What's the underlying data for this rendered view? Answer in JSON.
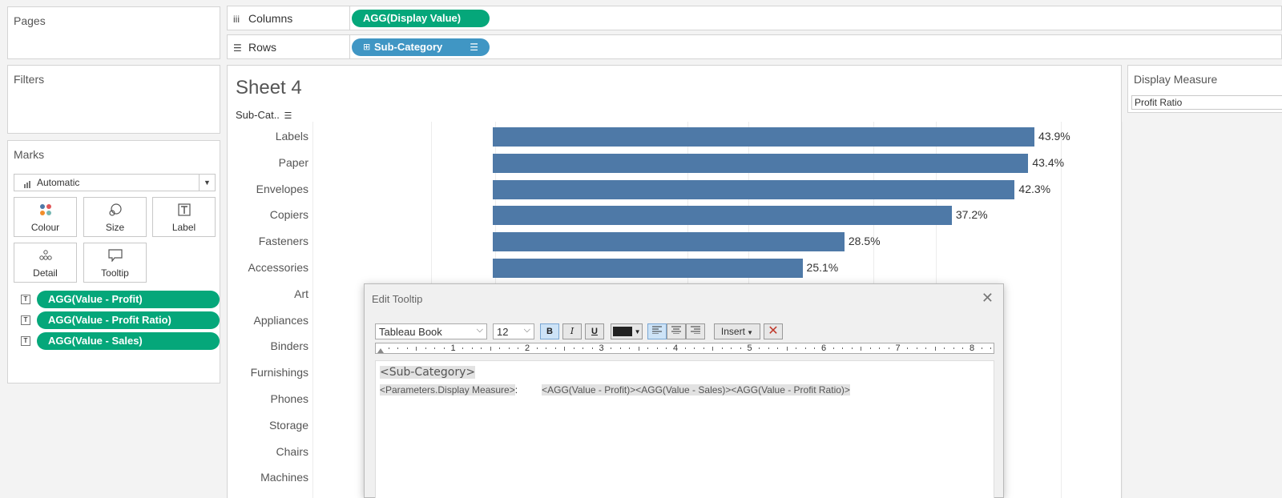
{
  "pages": {
    "title": "Pages"
  },
  "filters": {
    "title": "Filters"
  },
  "marks": {
    "title": "Marks",
    "mark_type": "Automatic",
    "buttons": [
      "Colour",
      "Size",
      "Label",
      "Detail",
      "Tooltip"
    ],
    "pills": [
      "AGG(Value - Profit)",
      "AGG(Value - Profit Ratio)",
      "AGG(Value - Sales)"
    ]
  },
  "columns_shelf": {
    "label": "Columns",
    "pill": "AGG(Display Value)"
  },
  "rows_shelf": {
    "label": "Rows",
    "pill": "Sub-Category"
  },
  "sheet": {
    "title": "Sheet 4",
    "row_header": "Sub-Cat.."
  },
  "chart_data": {
    "type": "bar",
    "categories": [
      "Labels",
      "Paper",
      "Envelopes",
      "Copiers",
      "Fasteners",
      "Accessories",
      "Art",
      "Appliances",
      "Binders",
      "Furnishings",
      "Phones",
      "Storage",
      "Chairs",
      "Machines"
    ],
    "values": [
      43.9,
      43.4,
      42.3,
      37.2,
      28.5,
      25.1,
      null,
      null,
      null,
      null,
      null,
      null,
      null,
      null
    ],
    "data_labels": [
      "43.9%",
      "43.4%",
      "42.3%",
      "37.2%",
      "28.5%",
      "25.1%",
      "",
      "",
      "",
      "",
      "",
      "",
      "",
      ""
    ],
    "title": "Sheet 4",
    "xlabel": "",
    "ylabel": "Sub-Cat..",
    "grid": true,
    "colors": {
      "bar": "#4e79a7"
    }
  },
  "parameter": {
    "title": "Display Measure",
    "value": "Profit Ratio"
  },
  "dialog": {
    "title": "Edit Tooltip",
    "font": "Tableau Book",
    "size": "12",
    "bold": "B",
    "italic": "I",
    "underline": "U",
    "insert": "Insert",
    "ruler_numbers": [
      "1",
      "2",
      "3",
      "4",
      "5",
      "6",
      "7",
      "8"
    ],
    "line1": "<Sub-Category>",
    "line2_param": "<Parameters.Display Measure>",
    "line2_sep": ":",
    "line2_fields": "<AGG(Value - Profit)><AGG(Value - Sales)><AGG(Value - Profit Ratio)>"
  },
  "colors": {
    "accent_green": "#05a77a",
    "accent_blue": "#4096c4"
  }
}
